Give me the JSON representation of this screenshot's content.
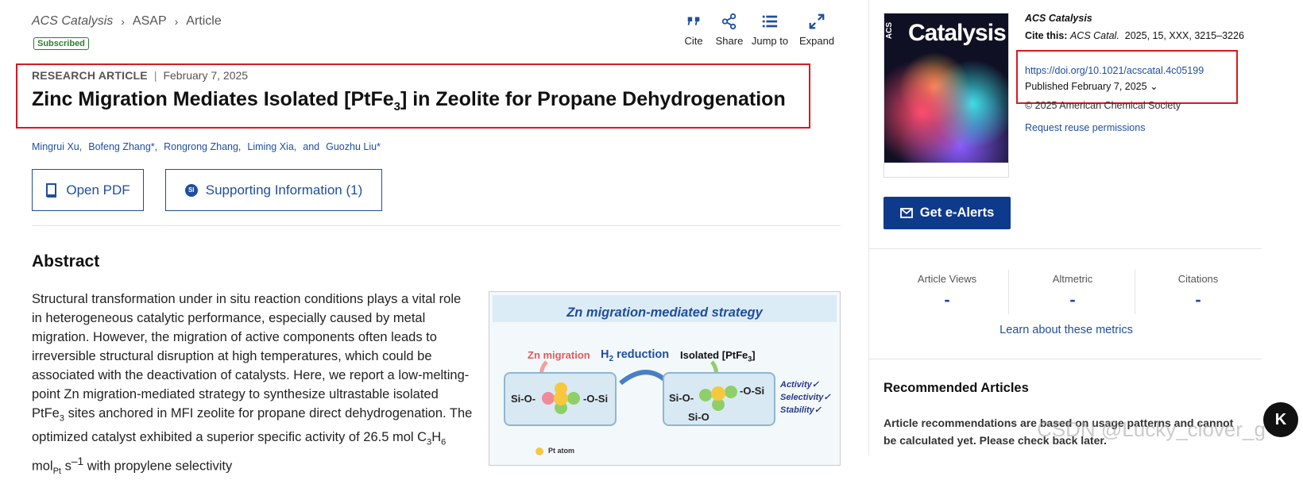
{
  "breadcrumb": {
    "journal": "ACS Catalysis",
    "section": "ASAP",
    "page": "Article"
  },
  "badge": "Subscribed",
  "toolbar": {
    "cite": "Cite",
    "share": "Share",
    "jump": "Jump to",
    "expand": "Expand"
  },
  "article": {
    "type": "RESEARCH ARTICLE",
    "date": "February 7, 2025",
    "title_a": "Zinc Migration Mediates Isolated [PtFe",
    "title_sub": "3",
    "title_b": "] in Zeolite for Propane Dehydrogenation",
    "authors": [
      "Mingrui Xu,",
      "Bofeng Zhang*,",
      "Rongrong Zhang,",
      "Liming Xia,",
      "and",
      "Guozhu Liu*"
    ]
  },
  "buttons": {
    "pdf": "Open PDF",
    "si_badge": "SI",
    "si": "Supporting Information (1)"
  },
  "abstract": {
    "heading": "Abstract",
    "p1": "Structural transformation under in situ reaction conditions plays a vital role in heterogeneous catalytic performance, especially caused by metal migration. However, the migration of active components often leads to irreversible structural disruption at high temperatures, which could be associated with the deactivation of catalysts. Here, we report a low-melting-point Zn migration-mediated strategy to synthesize ultrastable isolated PtFe",
    "p1_sub": "3",
    "p2": " sites anchored in MFI zeolite for propane direct dehydrogenation. The optimized catalyst exhibited a superior specific activity of 26.5 mol C",
    "p2_sub1": "3",
    "p2_mid": "H",
    "p2_sub2": "6",
    "p3": " mol",
    "p3_sup": "Pt",
    "p4": " s",
    "p4_sup": "–1",
    "p5": " with propylene selectivity"
  },
  "toc": {
    "title": "Zn migration-mediated strategy",
    "zn": "Zn migration",
    "h2a": "H",
    "h2sub": "2",
    "h2b": " reduction",
    "iso": "Isolated [PtFe",
    "iso_sub": "3",
    "iso_end": "]",
    "left_l": "Si-O-",
    "left_r": "-O-Si",
    "right_l": "Si-O-",
    "right_r": "-O-Si",
    "right_b": "Si-O",
    "activity": "Activity",
    "selectivity": "Selectivity",
    "stability": "Stability",
    "check": "✓",
    "pt": "Pt atom"
  },
  "side": {
    "cover_title": "Catalysis",
    "cover_acs": "ACS",
    "journal": "ACS Catalysis",
    "cite_label": "Cite this:",
    "cite_journal": "ACS Catal.",
    "cite_rest": "2025, 15, XXX, 3215–3226",
    "doi": "https://doi.org/10.1021/acscatal.4c05199",
    "published": "Published February 7, 2025",
    "copyright": "© 2025 American Chemical Society",
    "reuse": "Request reuse permissions",
    "alerts": "Get e-Alerts"
  },
  "metrics": {
    "items": [
      {
        "label": "Article Views",
        "value": "-"
      },
      {
        "label": "Altmetric",
        "value": "-"
      },
      {
        "label": "Citations",
        "value": "-"
      }
    ],
    "learn": "Learn about these metrics"
  },
  "recommended": {
    "heading": "Recommended Articles",
    "text": "Article recommendations are based on usage patterns and cannot be calculated yet. Please check back later."
  },
  "watermark": "CSDN @Lucky_clover_g",
  "fab": "K"
}
